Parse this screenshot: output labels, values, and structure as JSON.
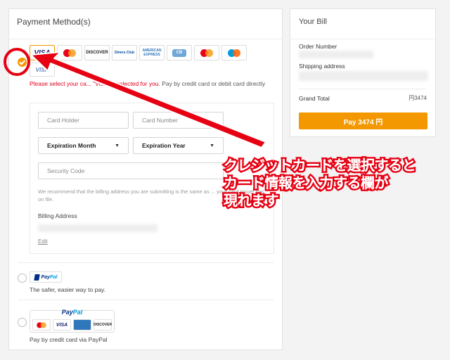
{
  "payment": {
    "title": "Payment Method(s)",
    "card_logos": [
      {
        "name": "visa",
        "label": "VISA",
        "selected": true
      },
      {
        "name": "mastercard",
        "label": ""
      },
      {
        "name": "discover",
        "label": "DISCOVER"
      },
      {
        "name": "diners",
        "label": "Diners Club"
      },
      {
        "name": "amex",
        "label": "AMERICAN EXPRESS"
      },
      {
        "name": "jcb",
        "label": "CB"
      },
      {
        "name": "mastercard-debit",
        "label": ""
      },
      {
        "name": "maestro",
        "label": ""
      },
      {
        "name": "visa-debit",
        "label": "VISA"
      }
    ],
    "selected_message_warn": "Please select your ca... \"Visa\" is selected for you.",
    "selected_message_rest": " Pay by credit card or debit card directly",
    "form": {
      "card_holder_placeholder": "Card Holder",
      "card_number_placeholder": "Card Number",
      "expiration_month": "Expiration Month",
      "expiration_year": "Expiration Year",
      "security_code_placeholder": "Security Code",
      "note": "We recommend that the billing address you are submitting is the same as ... your card issuer has on file.",
      "billing_address_label": "Billing Address",
      "edit_label": "Edit"
    },
    "paypal": {
      "logo_a": "Pay",
      "logo_b": "Pal",
      "description": "The safer, easier way to pay."
    },
    "paypal_card": {
      "logo_a": "Pay",
      "logo_b": "Pal",
      "visa": "VISA",
      "discover": "DISCOVER",
      "description": "Pay by credit card via PayPal"
    }
  },
  "bill": {
    "title": "Your Bill",
    "order_number_label": "Order Number",
    "shipping_address_label": "Shipping address",
    "grand_total_label": "Grand Total",
    "grand_total_value": "円3474",
    "pay_button": "Pay 3474 円"
  },
  "annotation": {
    "line1": "クレジットカードを選択すると",
    "line2": "カード情報を入力する欄が",
    "line3": "現れます",
    "color": "#e60012"
  }
}
